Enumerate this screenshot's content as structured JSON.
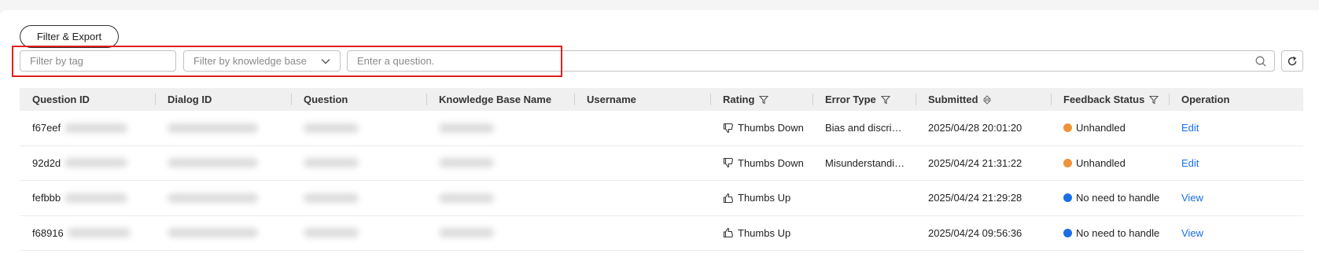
{
  "toolbar": {
    "filter_export_label": "Filter & Export"
  },
  "filters": {
    "tag_placeholder": "Filter by tag",
    "knowledge_base_placeholder": "Filter by knowledge base",
    "question_placeholder": "Enter a question."
  },
  "table": {
    "columns": [
      "Question ID",
      "Dialog ID",
      "Question",
      "Knowledge Base Name",
      "Username",
      "Rating",
      "Error Type",
      "Submitted",
      "Feedback Status",
      "Operation"
    ],
    "rows": [
      {
        "question_id": "f67eef",
        "rating": "Thumbs Down",
        "rating_icon": "thumbs-down-icon",
        "error_type": "Bias and discri…",
        "submitted": "2025/04/28 20:01:20",
        "status": "Unhandled",
        "status_color": "#f0923a",
        "operation": "Edit"
      },
      {
        "question_id": "92d2d",
        "rating": "Thumbs Down",
        "rating_icon": "thumbs-down-icon",
        "error_type": "Misunderstandi…",
        "submitted": "2025/04/24 21:31:22",
        "status": "Unhandled",
        "status_color": "#f0923a",
        "operation": "Edit"
      },
      {
        "question_id": "fefbbb",
        "rating": "Thumbs Up",
        "rating_icon": "thumbs-up-icon",
        "error_type": "",
        "submitted": "2025/04/24 21:29:28",
        "status": "No need to handle",
        "status_color": "#1a6fe6",
        "operation": "View"
      },
      {
        "question_id": "f68916",
        "rating": "Thumbs Up",
        "rating_icon": "thumbs-up-icon",
        "error_type": "",
        "submitted": "2025/04/24 09:56:36",
        "status": "No need to handle",
        "status_color": "#1a6fe6",
        "operation": "View"
      }
    ]
  },
  "colors": {
    "accent": "#1a6fe6",
    "highlight": "#e02020"
  }
}
